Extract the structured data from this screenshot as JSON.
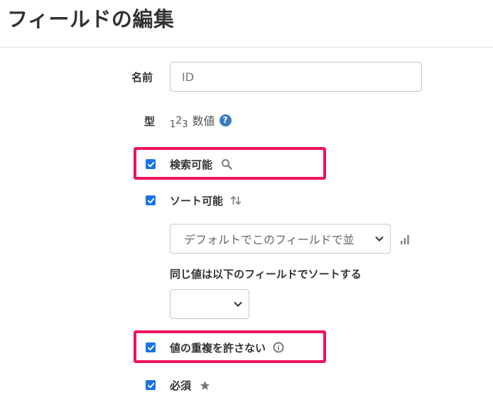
{
  "page": {
    "title": "フィールドの編集"
  },
  "form": {
    "name": {
      "label": "名前",
      "value": "ID"
    },
    "type": {
      "label": "型",
      "icon_digits": [
        "1",
        "2",
        "3"
      ],
      "value": "数値",
      "help_glyph": "?"
    },
    "searchable": {
      "label": "検索可能",
      "checked": true,
      "icon": "search-icon"
    },
    "sortable": {
      "label": "ソート可能",
      "checked": true,
      "icon": "sort-arrows-icon",
      "sort_select_value": "デフォルトでこのフィールドで並",
      "sort_select_icon": "bar-chart-icon"
    },
    "same_value_sort": {
      "label": "同じ値は以下のフィールドでソートする",
      "select_value": ""
    },
    "unique": {
      "label": "値の重複を許さない",
      "checked": true,
      "icon": "info-circle-icon",
      "icon_glyph": "i"
    },
    "required": {
      "label": "必須",
      "checked": true,
      "icon": "star-icon"
    }
  },
  "colors": {
    "checkbox": "#1a73e8",
    "highlight": "#f0145a",
    "help_icon": "#3a7bbf"
  }
}
